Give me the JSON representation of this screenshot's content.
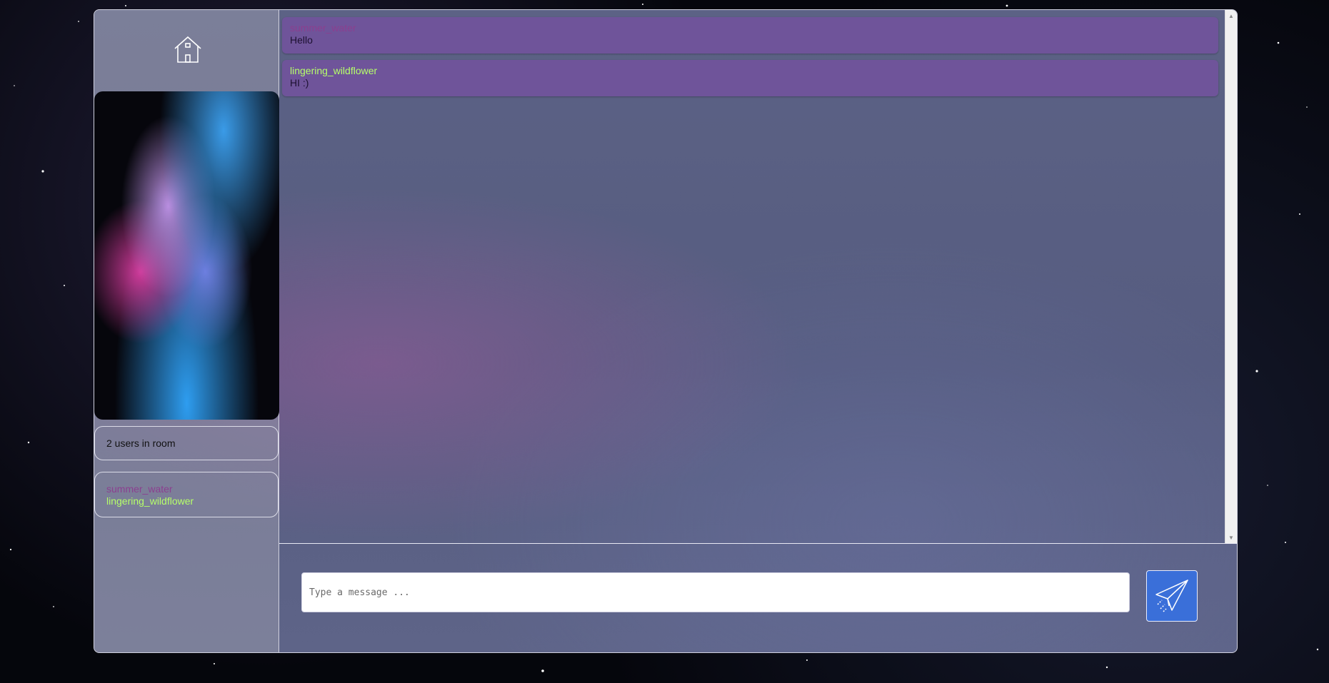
{
  "sidebar": {
    "home_icon": "home-icon",
    "room_image": "colorful ink smoke",
    "user_count_text": "2 users in room",
    "users": [
      {
        "name": "summer_water",
        "color": "#8b3f8f"
      },
      {
        "name": "lingering_wildflower",
        "color": "#b6ff6a"
      }
    ]
  },
  "chat": {
    "messages": [
      {
        "author": "summer_water",
        "author_color": "#8b3f8f",
        "text": "Hello"
      },
      {
        "author": "lingering_wildflower",
        "author_color": "#b6ff6a",
        "text": "HI :)"
      }
    ]
  },
  "composer": {
    "placeholder": "Type a message ...",
    "value": ""
  },
  "send_button": {
    "icon": "paper-plane-icon"
  },
  "colors": {
    "message_bg": "#6f549a",
    "send_button_bg": "#3a6fd9"
  }
}
